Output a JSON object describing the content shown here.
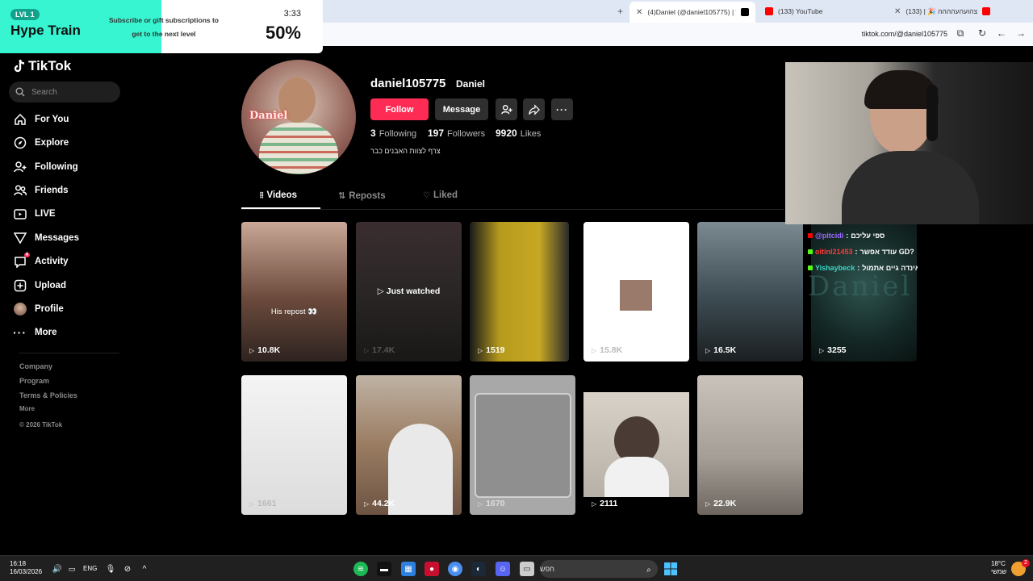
{
  "browser": {
    "tabs": [
      {
        "title": "(4)Daniel (@daniel105775) | Tik",
        "active": true
      },
      {
        "title": "(133) YouTube",
        "active": false
      },
      {
        "title": "צהועהעהההה 🎉 | (133)",
        "active": false
      }
    ],
    "url": "tiktok.com/@daniel105775"
  },
  "hype_train": {
    "level": "LVL 1",
    "title": "Hype Train",
    "subtitle": "Subscribe or gift subscriptions to get to the next level",
    "timer": "3:33",
    "percent": "50%",
    "progress": 0.5
  },
  "sidebar": {
    "logo": "TikTok",
    "search_placeholder": "Search",
    "items": [
      {
        "label": "For You",
        "icon": "home-icon"
      },
      {
        "label": "Explore",
        "icon": "compass-icon"
      },
      {
        "label": "Following",
        "icon": "user-plus-icon"
      },
      {
        "label": "Friends",
        "icon": "users-icon"
      },
      {
        "label": "LIVE",
        "icon": "tv-icon"
      },
      {
        "label": "Messages",
        "icon": "paper-plane-icon"
      },
      {
        "label": "Activity",
        "icon": "inbox-icon",
        "badge": "4"
      },
      {
        "label": "Upload",
        "icon": "plus-square-icon"
      },
      {
        "label": "Profile",
        "icon": "avatar-icon"
      },
      {
        "label": "More",
        "icon": "ellipsis-icon"
      }
    ],
    "footer": [
      "Company",
      "Program",
      "Terms & Policies",
      "More",
      "© 2026 TikTok"
    ]
  },
  "profile": {
    "username": "daniel105775",
    "nickname": "Daniel",
    "avatar_text": "Daniel",
    "follow_label": "Follow",
    "message_label": "Message",
    "stats": [
      {
        "value": "3",
        "label": "Following"
      },
      {
        "value": "197",
        "label": "Followers"
      },
      {
        "value": "9920",
        "label": "Likes"
      }
    ],
    "bio": "צרף לצוות האבנים כבר"
  },
  "tabs": [
    {
      "label": "Videos",
      "icon": "grid-icon",
      "active": true
    },
    {
      "label": "Reposts",
      "icon": "repost-icon",
      "active": false
    },
    {
      "label": "Liked",
      "icon": "heart-icon",
      "active": false
    }
  ],
  "videos": [
    {
      "views": "10.8K",
      "overlay": "His repost 👀",
      "bg": "#6b4a3c"
    },
    {
      "views": "17.4K",
      "overlay": "▷ Just watched",
      "bg": "#2a2626"
    },
    {
      "views": "1519",
      "overlay": "",
      "bg": "#8b7a20"
    },
    {
      "views": "15.8K",
      "overlay": "",
      "bg": "#ffffff"
    },
    {
      "views": "16.5K",
      "overlay": "",
      "bg": "#3c4b52"
    },
    {
      "views": "3255",
      "overlay": "",
      "bg": "#142826"
    },
    {
      "views": "1661",
      "overlay": "",
      "bg": "#e9e9e9"
    },
    {
      "views": "44.2K",
      "overlay": "",
      "bg": "#8a6a50"
    },
    {
      "views": "1670",
      "overlay": "",
      "bg": "#b5b5b5"
    },
    {
      "views": "2111",
      "overlay": "",
      "bg": "#cfcac2"
    },
    {
      "views": "22.9K",
      "overlay": "",
      "bg": "#a39d96"
    }
  ],
  "chat": {
    "watermark": "Daniel",
    "messages": [
      {
        "user": "@pitcidi",
        "text": "ספי עליכם",
        "platform_color": "#ff0000"
      },
      {
        "user": "oitinl21453",
        "text": "עודד אפשר GD?",
        "platform_color": "#53fc18"
      },
      {
        "user": "Yishaybeck",
        "text": "ורדון דיבר עליך בלייב של אינדה גיים אתמול",
        "platform_color": "#53fc18"
      }
    ]
  },
  "taskbar": {
    "time": "16:18",
    "date": "16/03/2026",
    "lang": "ENG",
    "search_placeholder": "חפש",
    "temperature": "18°C",
    "weather_text": "שמשי",
    "notif_count": "2"
  }
}
